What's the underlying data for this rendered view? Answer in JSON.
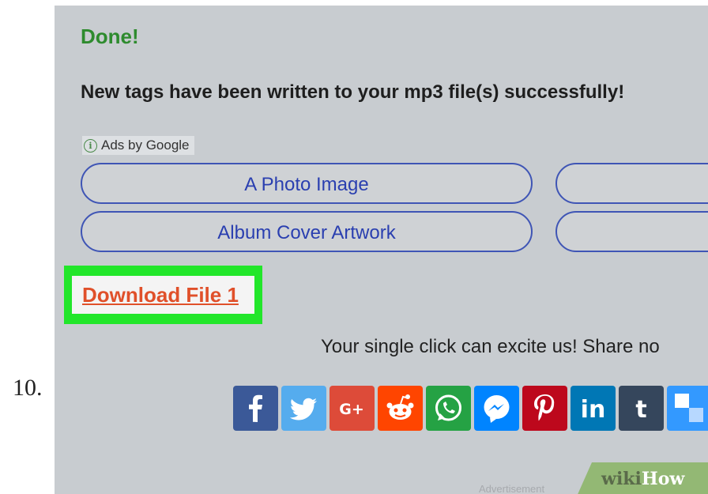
{
  "step": {
    "number": "10."
  },
  "result": {
    "title": "Done!",
    "message": "New tags have been written to your mp3 file(s) successfully!"
  },
  "ads": {
    "label": "Ads by Google",
    "info_icon": "info-icon",
    "buttons": [
      "A Photo Image",
      "Album Cover Artwork"
    ]
  },
  "download": {
    "label": "Download File 1",
    "highlight_color": "#22e62a",
    "link_color": "#e0502a"
  },
  "share": {
    "text": "Your single click can excite us! Share no",
    "icons": [
      "facebook-icon",
      "twitter-icon",
      "google-plus-icon",
      "reddit-icon",
      "whatsapp-icon",
      "messenger-icon",
      "pinterest-icon",
      "linkedin-icon",
      "tumblr-icon",
      "delicious-icon"
    ]
  },
  "footer": {
    "advertisement": "Advertisement",
    "brand_wiki": "wiki",
    "brand_how": "How"
  },
  "colors": {
    "background": "#c8ccd0",
    "done_title": "#2e8b2e",
    "ad_button_border": "#3f55b5",
    "facebook": "#3b5998",
    "twitter": "#55acee",
    "google_plus": "#dd4b39",
    "reddit": "#ff4500",
    "whatsapp": "#25a244",
    "messenger": "#0084ff",
    "pinterest": "#bd081c",
    "linkedin": "#0077b5",
    "tumblr": "#35465c"
  }
}
